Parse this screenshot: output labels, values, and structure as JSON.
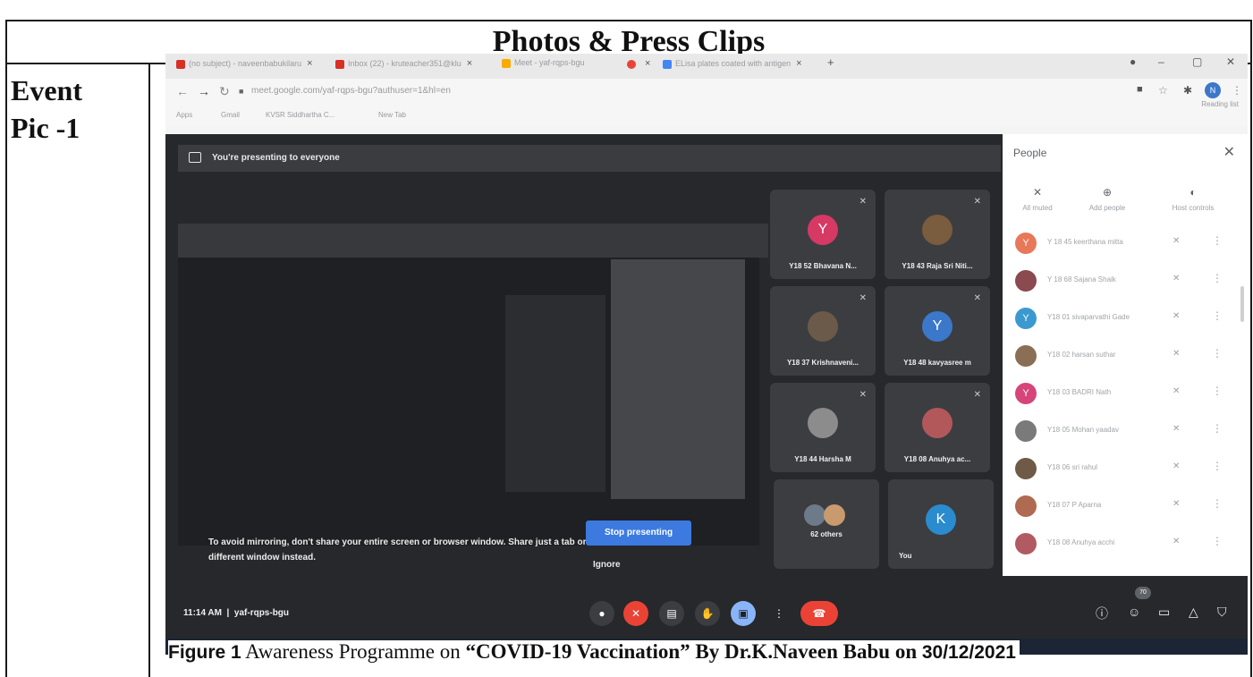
{
  "document": {
    "title": "Photos & Press Clips",
    "row_label_line1": "Event",
    "row_label_line2": "Pic -1"
  },
  "browser": {
    "tabs": [
      {
        "label": "(no subject) - naveenbabukilaru",
        "favicon_color": "#d93025"
      },
      {
        "label": "Inbox (22) - kruteacher351@klu",
        "favicon_color": "#d93025"
      },
      {
        "label": "Meet - yaf-rqps-bgu",
        "favicon_color": "#f9ab00"
      },
      {
        "label": "",
        "favicon_color": "#ea4335"
      },
      {
        "label": "ELisa plates coated with antigen",
        "favicon_color": "#4285f4"
      }
    ],
    "new_tab_symbol": "+",
    "url": "meet.google.com/yaf-rqps-bgu?authuser=1&hl=en",
    "bookmarks": [
      "Apps",
      "Gmail",
      "KVSR Siddhartha C...",
      "New Tab"
    ],
    "reading_list": "Reading list",
    "profile_initial": "N"
  },
  "meet": {
    "presenting_banner": "You're presenting to everyone",
    "mirror_warning": "To avoid mirroring, don't share your entire screen or browser window. Share just a tab or a different window instead.",
    "stop_presenting": "Stop presenting",
    "ignore": "Ignore",
    "tiles": [
      {
        "name": "Y18 52 Bhavana N...",
        "initial": "Y",
        "color": "#d63964"
      },
      {
        "name": "Y18 43 Raja Sri Niti...",
        "initial": "",
        "color": "#7a5c3e"
      },
      {
        "name": "Y18 37 Krishnaveni...",
        "initial": "",
        "color": "#6b5a4a"
      },
      {
        "name": "Y18 48 kavyasree m",
        "initial": "Y",
        "color": "#3b78c9"
      },
      {
        "name": "Y18 44 Harsha M",
        "initial": "",
        "color": "#8c8c8c"
      },
      {
        "name": "Y18 08 Anuhya ac...",
        "initial": "",
        "color": "#b2585a"
      },
      {
        "name": "62 others",
        "initial": "",
        "color": "#6d7a8a"
      },
      {
        "name": "You",
        "initial": "K",
        "color": "#2a8ccf"
      }
    ],
    "clock": "11:14 AM",
    "meeting_code": "yaf-rqps-bgu",
    "participant_count": "70"
  },
  "people_panel": {
    "title": "People",
    "controls": [
      "All muted",
      "Add people",
      "Host controls"
    ],
    "participants": [
      {
        "name": "Y 18 45 keerthana mitta",
        "initial": "Y",
        "color": "#e8785a"
      },
      {
        "name": "Y 18 68 Sajana Shaik",
        "initial": "",
        "color": "#8a4a50"
      },
      {
        "name": "Y18 01 sivaparvathi Gade",
        "initial": "Y",
        "color": "#3a9ad0"
      },
      {
        "name": "Y18 02 harsan suthar",
        "initial": "",
        "color": "#8a6e55"
      },
      {
        "name": "Y18 03 BADRI Nath",
        "initial": "Y",
        "color": "#d6457a"
      },
      {
        "name": "Y18 05 Mohan yaadav",
        "initial": "",
        "color": "#7a7a7a"
      },
      {
        "name": "Y18 06 sri rahul",
        "initial": "",
        "color": "#6e5a46"
      },
      {
        "name": "Y18 07 P Aparna",
        "initial": "",
        "color": "#b06a52"
      },
      {
        "name": "Y18 08 Anuhya acchi",
        "initial": "",
        "color": "#b25a62"
      }
    ]
  },
  "caption": {
    "figure": "Figure 1",
    "prefix": " Awareness Programme on ",
    "topic": "“COVID-19 Vaccination” By Dr.K.Naveen Babu on ",
    "date": "30/12/2021"
  }
}
